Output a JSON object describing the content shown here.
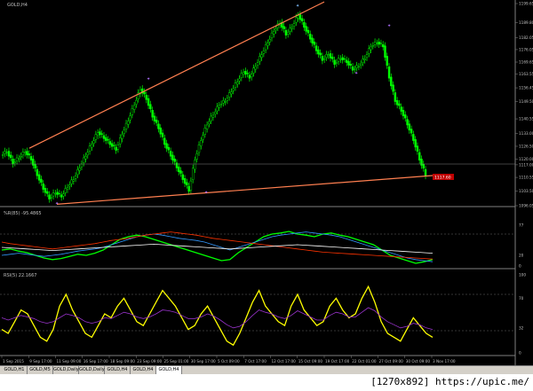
{
  "chart_data": [
    {
      "type": "candlestick",
      "title": "GOLD,H4",
      "ylim": [
        1096.05,
        1199.65
      ],
      "yticks": [
        "1199.65",
        "1189.80",
        "1182.05",
        "1176.05",
        "1169.65",
        "1163.55",
        "1156.45",
        "1149.50",
        "1140.55",
        "1133.00",
        "1126.50",
        "1120.00",
        "1117.00",
        "1110.55",
        "1103.50",
        "1096.05"
      ],
      "current_price": "1117.60",
      "trendlines": [
        {
          "from": [
            "9 Sep 2015",
            1125.5
          ],
          "to": [
            "15 Oct 09:00",
            1200.5
          ],
          "color": "#ff7f50"
        },
        {
          "from": [
            "11 Sep 09:00",
            1096.8
          ],
          "to": [
            "3 Nov 17:00",
            1111.5
          ],
          "color": "#ff7f50"
        }
      ],
      "close_series": [
        1122,
        1124,
        1118,
        1121,
        1124,
        1120,
        1112,
        1105,
        1100,
        1103,
        1101,
        1106,
        1110,
        1116,
        1122,
        1128,
        1134,
        1131,
        1128,
        1125,
        1133,
        1140,
        1148,
        1156,
        1151,
        1142,
        1136,
        1128,
        1122,
        1116,
        1110,
        1104,
        1120,
        1130,
        1138,
        1143,
        1148,
        1150,
        1155,
        1160,
        1165,
        1162,
        1168,
        1174,
        1180,
        1186,
        1190,
        1184,
        1188,
        1194,
        1188,
        1182,
        1176,
        1171,
        1174,
        1169,
        1172,
        1170,
        1166,
        1168,
        1172,
        1178,
        1180,
        1178,
        1162,
        1150,
        1145,
        1138,
        1130,
        1120,
        1112
      ]
    },
    {
      "type": "line",
      "title": "%R(85) -95.4865",
      "ylim": [
        0,
        100
      ],
      "yticks": [
        "77",
        "20",
        "0"
      ],
      "series": [
        {
          "color": "#00ff00",
          "values": [
            30,
            32,
            28,
            25,
            20,
            15,
            12,
            14,
            18,
            22,
            20,
            24,
            30,
            40,
            50,
            55,
            58,
            55,
            50,
            45,
            40,
            35,
            30,
            25,
            20,
            15,
            10,
            12,
            25,
            35,
            45,
            55,
            60,
            62,
            65,
            60,
            58,
            55,
            60,
            62,
            58,
            55,
            50,
            45,
            40,
            30,
            20,
            15,
            10,
            5,
            8,
            12
          ]
        },
        {
          "color": "#3399ff",
          "values": [
            20,
            22,
            24,
            22,
            20,
            18,
            20,
            22,
            25,
            28,
            30,
            32,
            35,
            40,
            45,
            50,
            55,
            58,
            60,
            58,
            55,
            52,
            50,
            48,
            45,
            40,
            35,
            30,
            35,
            40,
            45,
            50,
            55,
            58,
            60,
            62,
            64,
            62,
            60,
            58,
            55,
            50,
            45,
            40,
            35,
            30,
            25,
            20,
            15,
            12,
            10,
            8
          ]
        },
        {
          "color": "#ff3300",
          "values": [
            45,
            42,
            40,
            38,
            36,
            34,
            32,
            34,
            36,
            38,
            40,
            42,
            45,
            48,
            50,
            52,
            55,
            58,
            60,
            62,
            64,
            62,
            60,
            58,
            55,
            52,
            50,
            48,
            46,
            44,
            42,
            40,
            38,
            36,
            34,
            32,
            30,
            28,
            26,
            25,
            24,
            23,
            22,
            21,
            20,
            19,
            18,
            17,
            16,
            15,
            14,
            13
          ]
        },
        {
          "color": "#ffffff",
          "values": [
            35,
            34,
            33,
            32,
            31,
            30,
            29,
            30,
            31,
            32,
            33,
            34,
            35,
            36,
            37,
            38,
            39,
            40,
            41,
            40,
            39,
            38,
            37,
            36,
            35,
            34,
            33,
            32,
            33,
            34,
            35,
            36,
            37,
            38,
            39,
            40,
            39,
            38,
            37,
            36,
            35,
            34,
            33,
            32,
            31,
            30,
            29,
            28,
            27,
            26,
            25,
            24
          ]
        }
      ]
    },
    {
      "type": "line",
      "title": "RSI(5) 22.1667",
      "ylim": [
        0,
        100
      ],
      "yticks": [
        "100",
        "70",
        "32",
        "0"
      ],
      "series": [
        {
          "color": "#ffff00",
          "values": [
            30,
            25,
            40,
            55,
            50,
            35,
            20,
            15,
            30,
            60,
            75,
            55,
            40,
            25,
            20,
            35,
            50,
            45,
            60,
            70,
            55,
            40,
            35,
            50,
            65,
            80,
            70,
            60,
            45,
            30,
            35,
            50,
            60,
            45,
            30,
            15,
            10,
            25,
            45,
            65,
            80,
            60,
            50,
            40,
            35,
            60,
            75,
            55,
            45,
            35,
            40,
            60,
            70,
            55,
            45,
            50,
            70,
            85,
            65,
            40,
            25,
            20,
            15,
            30,
            45,
            35,
            25,
            20
          ]
        },
        {
          "color": "#9933cc",
          "values": [
            45,
            42,
            45,
            48,
            46,
            44,
            40,
            38,
            40,
            45,
            50,
            48,
            45,
            40,
            38,
            40,
            45,
            44,
            48,
            52,
            50,
            46,
            44,
            46,
            50,
            55,
            54,
            52,
            48,
            44,
            44,
            46,
            50,
            47,
            42,
            36,
            32,
            34,
            40,
            48,
            55,
            52,
            50,
            46,
            44,
            48,
            54,
            50,
            46,
            42,
            42,
            48,
            52,
            50,
            46,
            46,
            52,
            58,
            54,
            46,
            40,
            36,
            32,
            34,
            38,
            36,
            32,
            30
          ]
        }
      ]
    }
  ],
  "xaxis_labels": [
    "1 Sep 2015",
    "9 Sep 17:00",
    "11 Sep 09:00",
    "16 Sep 17:00",
    "18 Sep 09:00",
    "23 Sep 09:00",
    "25 Sep 01:00",
    "30 Sep 17:00",
    "5 Oct 09:00",
    "7 Oct 17:00",
    "12 Oct 17:00",
    "15 Oct 09:00",
    "19 Oct 17:00",
    "22 Oct 01:00",
    "27 Oct 09:00",
    "30 Oct 09:00",
    "3 Nov 17:00"
  ],
  "tabs": [
    "GOLD,H1",
    "GOLD,M5",
    "GOLD,Daily",
    "GOLD,Daily",
    "GOLD,H4",
    "GOLD,H4",
    "GOLD,H4"
  ],
  "watermark": "[1270x892] https://upic.me/",
  "colors": {
    "bull": "#00ff00",
    "bear": "#00ff00",
    "trend": "#ff7f50",
    "grid": "#808080",
    "axis_text": "#c0c0c0",
    "price_tag": "#c00000"
  }
}
